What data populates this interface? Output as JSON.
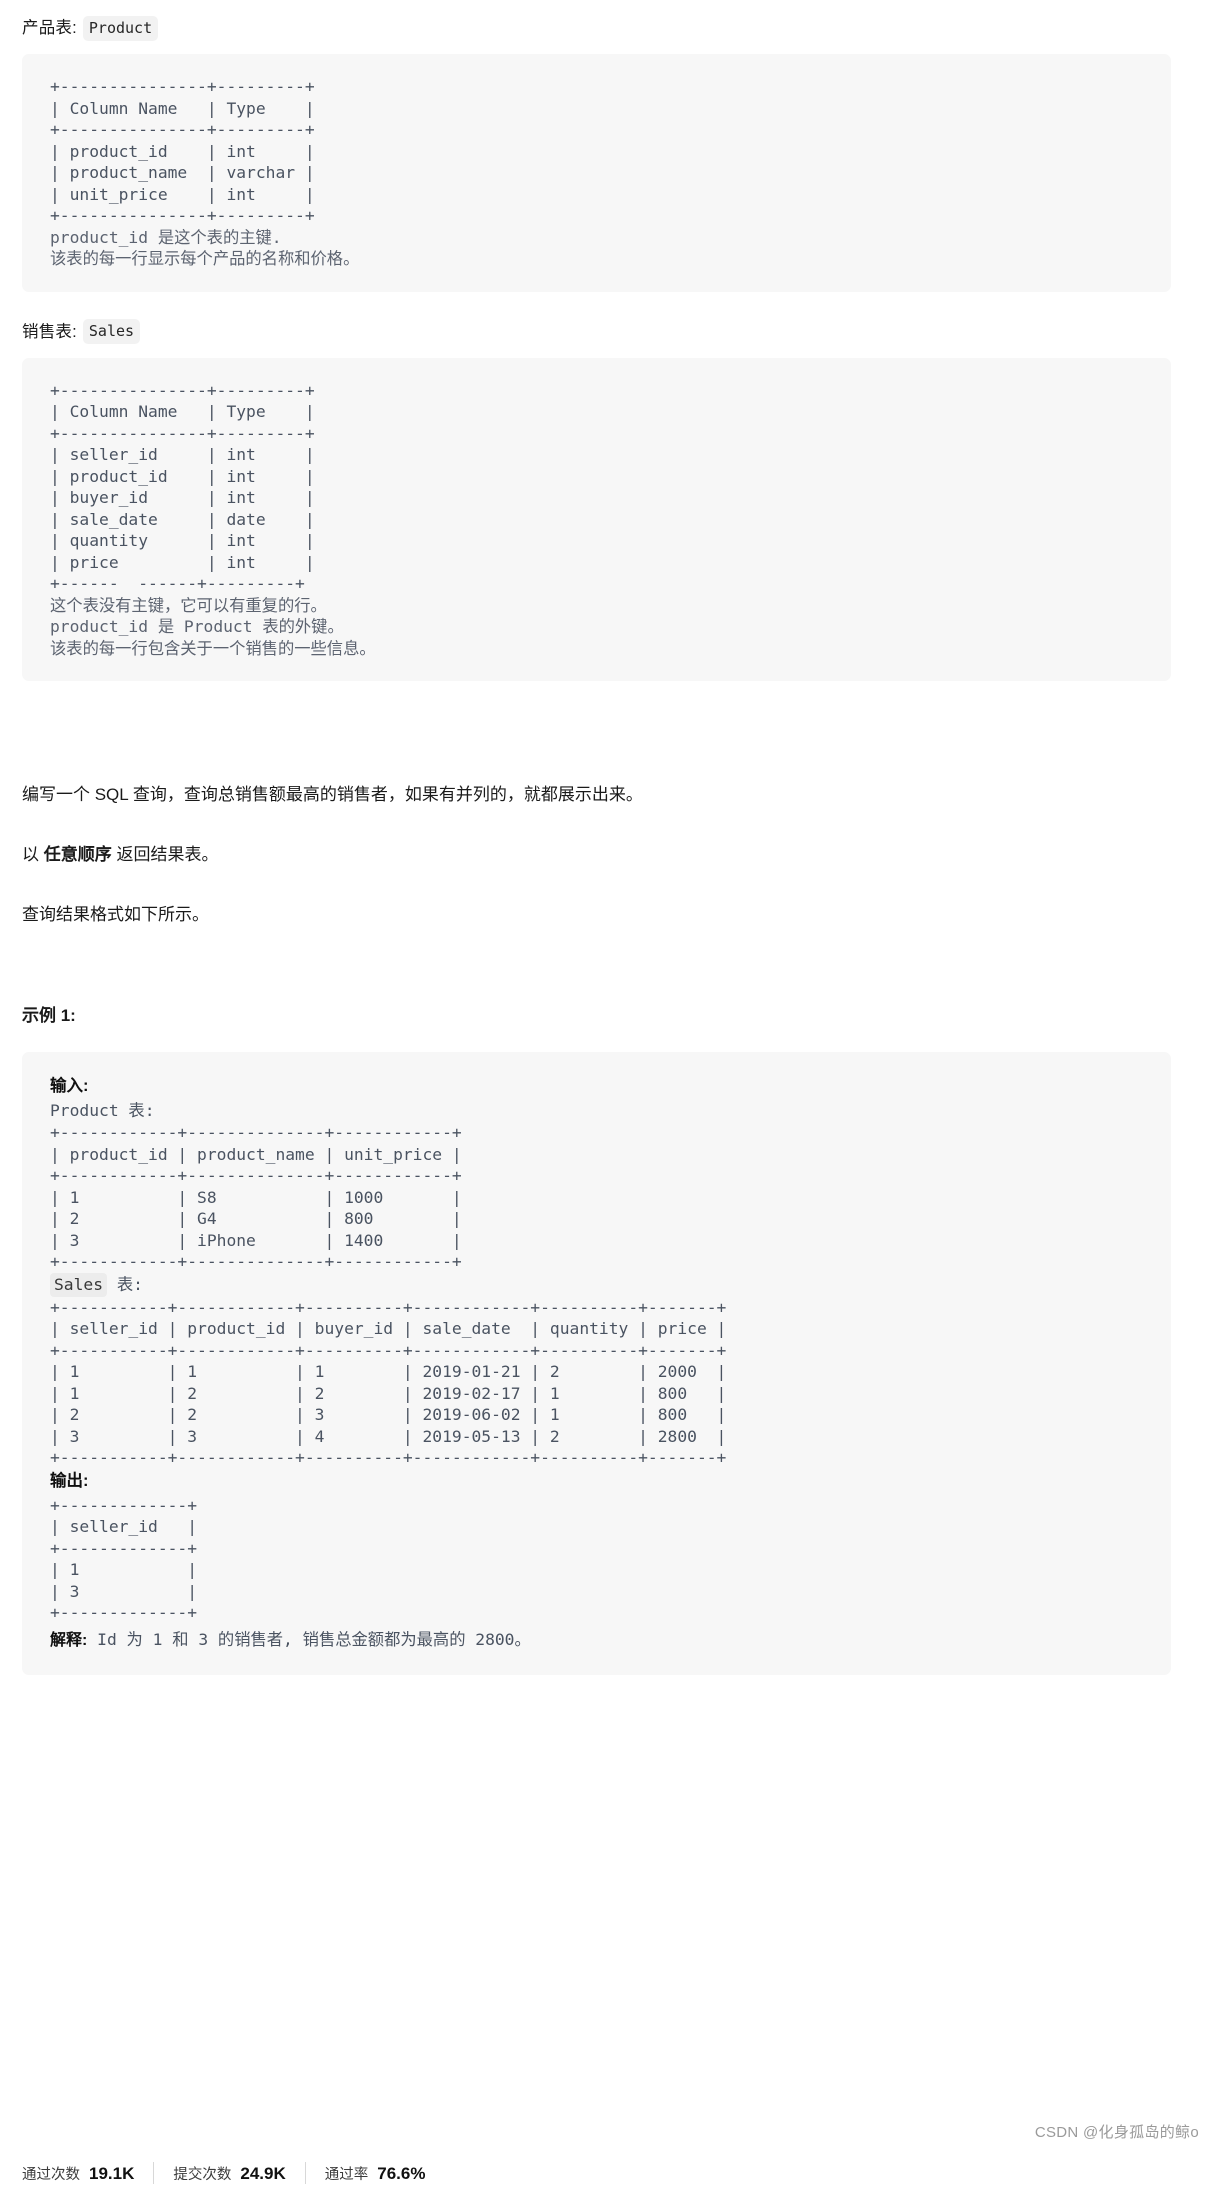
{
  "product_section": {
    "caption_label": "产品表:",
    "caption_code": "Product",
    "ascii": "+---------------+---------+\n| Column Name   | Type    |\n+---------------+---------+\n| product_id    | int     |\n| product_name  | varchar |\n| unit_price    | int     |\n+---------------+---------+",
    "notes": "product_id 是这个表的主键.\n该表的每一行显示每个产品的名称和价格。"
  },
  "sales_section": {
    "caption_label": "销售表:",
    "caption_code": "Sales",
    "ascii": "+---------------+---------+\n| Column Name   | Type    |\n+---------------+---------+\n| seller_id     | int     |\n| product_id    | int     |\n| buyer_id      | int     |\n| sale_date     | date    |\n| quantity      | int     |\n| price         | int     |\n+------  ------+---------+",
    "notes": "这个表没有主键，它可以有重复的行。\nproduct_id 是 Product 表的外键。\n该表的每一行包含关于一个销售的一些信息。"
  },
  "question": {
    "line1": "编写一个 SQL 查询，查询总销售额最高的销售者，如果有并列的，就都展示出来。",
    "line2_prefix": "以 ",
    "line2_bold": "任意顺序",
    "line2_suffix": " 返回结果表。",
    "line3": "查询结果格式如下所示。"
  },
  "example": {
    "title": "示例 1:",
    "input_label": "输入:",
    "product_table_label": "Product 表:",
    "product_ascii": "+------------+--------------+------------+\n| product_id | product_name | unit_price |\n+------------+--------------+------------+\n| 1          | S8           | 1000       |\n| 2          | G4           | 800        |\n| 3          | iPhone       | 1400       |\n+------------+--------------+------------+",
    "sales_table_code": "Sales",
    "sales_table_suffix": " 表:",
    "sales_ascii": "+-----------+------------+----------+------------+----------+-------+\n| seller_id | product_id | buyer_id | sale_date  | quantity | price |\n+-----------+------------+----------+------------+----------+-------+\n| 1         | 1          | 1        | 2019-01-21 | 2        | 2000  |\n| 1         | 2          | 2        | 2019-02-17 | 1        | 800   |\n| 2         | 2          | 3        | 2019-06-02 | 1        | 800   |\n| 3         | 3          | 4        | 2019-05-13 | 2        | 2800  |\n+-----------+------------+----------+------------+----------+-------+",
    "output_label": "输出:",
    "output_ascii": "+-------------+\n| seller_id   |\n+-------------+\n| 1           |\n| 3           |\n+-------------+",
    "explain_label": "解释:",
    "explain_text": " Id 为 1 和 3 的销售者, 销售总金额都为最高的 2800。"
  },
  "footer": {
    "stats": [
      {
        "label": "通过次数",
        "value": "19.1K"
      },
      {
        "label": "提交次数",
        "value": "24.9K"
      },
      {
        "label": "通过率",
        "value": "76.6%"
      }
    ],
    "watermark": "CSDN @化身孤岛的鲸o"
  }
}
